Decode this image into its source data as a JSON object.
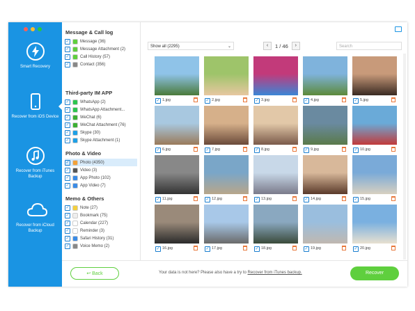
{
  "sidebar": {
    "items": [
      {
        "label": "Smart Recovery",
        "icon": "lightning-icon"
      },
      {
        "label": "Recover from iOS Device",
        "icon": "iphone-icon"
      },
      {
        "label": "Recover from iTunes Backup",
        "icon": "music-note-icon"
      },
      {
        "label": "Recover from iCloud Backup",
        "icon": "cloud-icon"
      }
    ]
  },
  "categories": {
    "message": {
      "title": "Message & Call log",
      "items": [
        "Message (36)",
        "Message Attachment (2)",
        "Call History (57)",
        "Contact (356)"
      ]
    },
    "im": {
      "title": "Third-party IM APP",
      "items": [
        "WhatsApp (2)",
        "WhatsApp Attachment...",
        "WeChat (6)",
        "WeChat Attachment (76)",
        "Skype (30)",
        "Skype Attachment (1)"
      ]
    },
    "photo": {
      "title": "Photo & Video",
      "items": [
        "Photo (4350)",
        "Video (3)",
        "App Photo (102)",
        "App Video (7)"
      ]
    },
    "memo": {
      "title": "Memo & Others",
      "items": [
        "Note (27)",
        "Bookmark (75)",
        "Calendar (227)",
        "Reminder (3)",
        "Safari History (31)",
        "Voice Memo (2)"
      ]
    }
  },
  "toolbar": {
    "filter": "Show all (2295)",
    "page": "1 / 46",
    "search_placeholder": "Search"
  },
  "photos": [
    "1.jpg",
    "2.jpg",
    "3.jpg",
    "4.jpg",
    "5.jpg",
    "6.jpg",
    "7.jpg",
    "8.jpg",
    "9.jpg",
    "10.jpg",
    "11.jpg",
    "12.jpg",
    "13.jpg",
    "14.jpg",
    "15.jpg",
    "16.jpg",
    "17.jpg",
    "18.jpg",
    "19.jpg",
    "20.jpg"
  ],
  "footer": {
    "back": "Back",
    "hint": "Your data is not here? Please also have a try to",
    "hint_link": "Recover from iTunes backup.",
    "recover": "Recover"
  },
  "colors": {
    "sidebar": "#1a94e3",
    "accent_green": "#5fcf3e",
    "checkbox": "#1a7fd0",
    "trash": "#e8773a"
  }
}
